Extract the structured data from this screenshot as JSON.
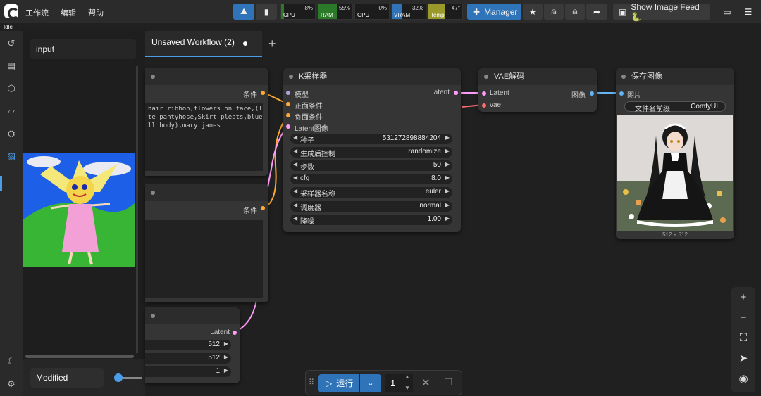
{
  "menu": {
    "workflow": "工作流",
    "edit": "编辑",
    "help": "帮助"
  },
  "monitor": [
    {
      "label": "CPU",
      "percent": "8%",
      "fill": 0.08,
      "color": "#2a7a2a"
    },
    {
      "label": "RAM",
      "percent": "55%",
      "fill": 0.55,
      "color": "#2a7a2a"
    },
    {
      "label": "GPU",
      "percent": "0%",
      "fill": 0.0,
      "color": "#2a7a2a"
    },
    {
      "label": "VRAM",
      "percent": "32%",
      "fill": 0.32,
      "color": "#2f73b8"
    },
    {
      "label": "Temp",
      "percent": "47°",
      "fill": 0.47,
      "color": "#9a9a2a"
    }
  ],
  "toolbar": {
    "manager_label": "Manager",
    "image_feed_label": "Show Image Feed 🐍"
  },
  "status": {
    "state": "Idle"
  },
  "panel": {
    "search_value": "input",
    "footer_label": "Modified"
  },
  "tabs": [
    {
      "label": "Unsaved Workflow (2)"
    }
  ],
  "nodes": {
    "prompt_pos": {
      "output_label": "条件",
      "text": "hair ribbon,flowers on face,(long\nte pantyhose,Skirt pleats,blue\nll body),mary janes"
    },
    "prompt_neg": {
      "output_label": "条件"
    },
    "ksampler": {
      "title": "K采样器",
      "inputs": [
        "模型",
        "正面条件",
        "负面条件",
        "Latent图像"
      ],
      "output": "Latent",
      "widgets": [
        {
          "label": "种子",
          "value": "531272898884204"
        },
        {
          "label": "生成后控制",
          "value": "randomize"
        },
        {
          "label": "步数",
          "value": "50"
        },
        {
          "label": "cfg",
          "value": "8.0"
        },
        {
          "label": "采样器名称",
          "value": "euler"
        },
        {
          "label": "调度器",
          "value": "normal"
        },
        {
          "label": "降噪",
          "value": "1.00"
        }
      ]
    },
    "vae_decode": {
      "title": "VAE解码",
      "inputs": [
        "Latent",
        "vae"
      ],
      "output": "图像"
    },
    "save_image": {
      "title": "保存图像",
      "input": "图片",
      "prefix_label": "文件名前缀",
      "prefix_value": "ComfyUI",
      "image_size": "512 × 512"
    },
    "latent": {
      "output": "Latent",
      "widgets": [
        "512",
        "512",
        "1"
      ]
    }
  },
  "runbar": {
    "run_label": "运行",
    "batch_value": "1"
  },
  "colors": {
    "accent": "#2f73b8",
    "model": "#b39ddb",
    "conditioning": "#ffa931",
    "latent": "#ff9cf9",
    "vae": "#ff6e6e",
    "image": "#64b5f6"
  }
}
